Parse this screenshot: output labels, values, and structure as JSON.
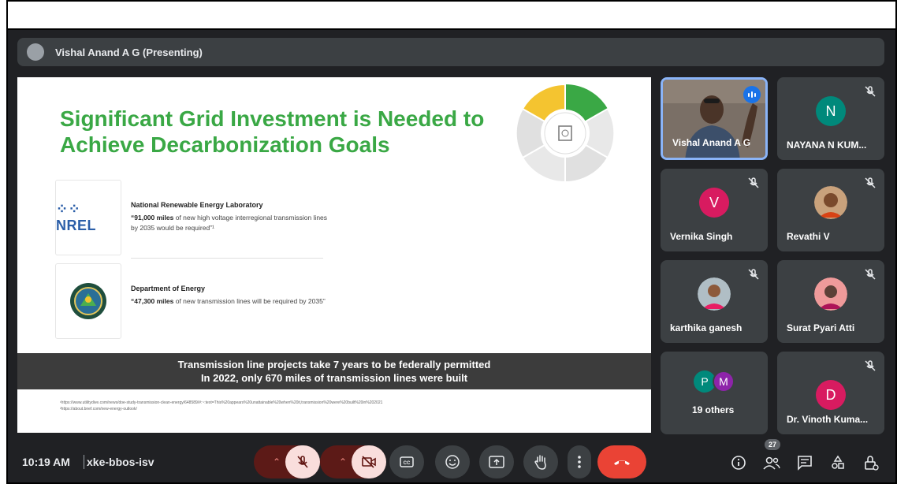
{
  "presenter_bar": {
    "name": "Vishal Anand A G (Presenting)"
  },
  "slide": {
    "title": "Significant Grid Investment is Needed to Achieve Decarbonization Goals",
    "nrel_logo": "NREL",
    "nrel": {
      "org": "National Renewable Energy Laboratory",
      "quote_bold": "“91,000 miles",
      "quote_rest": " of new high voltage interregional transmission lines by 2035 would be required”¹"
    },
    "doe": {
      "org": "Department of Energy",
      "quote_bold": "“47,300 miles",
      "quote_rest": " of new transmission lines will be required by 2035”"
    },
    "banner_line1": "Transmission line projects take 7 years to be federally permitted",
    "banner_line2": "In 2022, only 670 miles of transmission lines were built",
    "footnote1": "¹https://www.utilitydive.com/news/doe-study-transmission-clean-energy/648589/#:~:text=This%20appears%20unattainable%20when%20it,transmission%20were%20built%20in%202021",
    "footnote2": "²https://about.bnef.com/new-energy-outlook/"
  },
  "tiles": [
    {
      "name": "Vishal Anand A G",
      "type": "video"
    },
    {
      "name": "NAYANA N KUM...",
      "initial": "N",
      "color": "#00897b"
    },
    {
      "name": "Vernika Singh",
      "initial": "V",
      "color": "#d81b60"
    },
    {
      "name": "Revathi V",
      "type": "photo"
    },
    {
      "name": "karthika ganesh",
      "type": "photo"
    },
    {
      "name": "Surat Pyari Atti",
      "type": "photo"
    },
    {
      "name": "19 others",
      "initials": [
        "P",
        "M"
      ],
      "colors": [
        "#00897b",
        "#8e24aa"
      ]
    },
    {
      "name": "Dr. Vinoth Kuma...",
      "initial": "D",
      "color": "#d81b60"
    }
  ],
  "bottom": {
    "time": "10:19 AM",
    "meeting_code": "xke-bbos-isv",
    "people_count": "27"
  },
  "colors": {
    "accent_green": "#3aa845",
    "end_call": "#ea4335",
    "speaking": "#1a73e8"
  },
  "icons": [
    "mic-off-icon",
    "camera-off-icon",
    "captions-icon",
    "emoji-icon",
    "present-icon",
    "raise-hand-icon",
    "more-options-icon",
    "end-call-icon",
    "info-icon",
    "people-icon",
    "chat-icon",
    "activities-icon",
    "host-controls-icon"
  ]
}
